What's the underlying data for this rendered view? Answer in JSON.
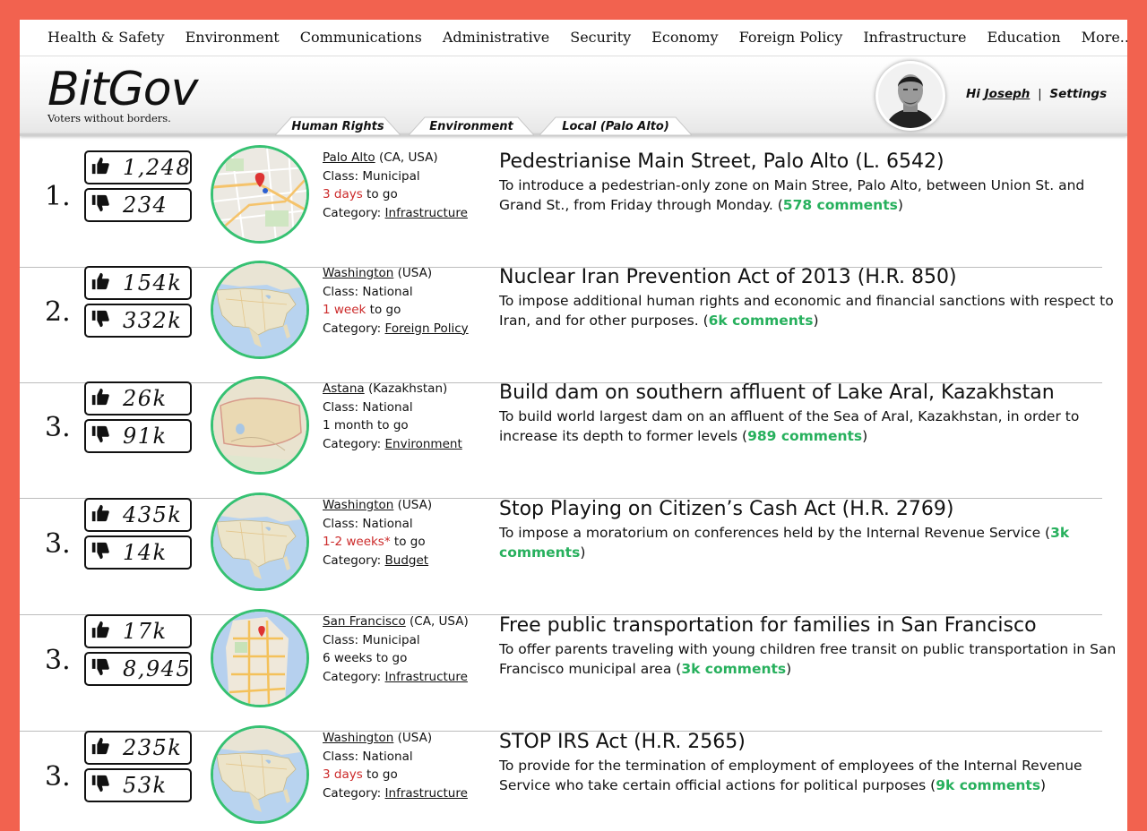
{
  "topnav": [
    "Health & Safety",
    "Environment",
    "Communications",
    "Administrative",
    "Security",
    "Economy",
    "Foreign Policy",
    "Infrastructure",
    "Education",
    "More..."
  ],
  "brand": {
    "logo": "BitGov",
    "tagline": "Voters without borders."
  },
  "user": {
    "greeting": "Hi",
    "name": "Joseph",
    "separator": "|",
    "settings": "Settings"
  },
  "tabs": [
    "Human Rights",
    "Environment",
    "Local (Palo Alto)"
  ],
  "colors": {
    "background": "#f2624f",
    "accent_green": "#36c172",
    "comment_green": "#27b05d",
    "deadline_red": "#cc2a2a"
  },
  "labels": {
    "class": "Class:",
    "category": "Category:",
    "to_go": "to go"
  },
  "items": [
    {
      "rank": "1.",
      "up": "1,248",
      "down": "234",
      "place": "Palo Alto",
      "place_note": " (CA, USA)",
      "class": "Municipal",
      "deadline": "3 days",
      "deadline_red": true,
      "category": "Infrastructure",
      "map": "city-map",
      "title": "Pedestrianise Main Street, Palo Alto (L. 6542)",
      "desc": "To introduce a pedestrian-only zone on Main Stree, Palo Alto, between Union St. and Grand St., from Friday through Monday. (",
      "comments": "578 comments",
      "close": ")"
    },
    {
      "rank": "2.",
      "up": "154k",
      "down": "332k",
      "place": "Washington",
      "place_note": " (USA)",
      "class": "National",
      "deadline": "1 week",
      "deadline_red": true,
      "category": "Foreign Policy",
      "map": "usa-map",
      "title": "Nuclear Iran Prevention Act of 2013 (H.R. 850)",
      "desc": "To impose additional human rights and economic and financial sanctions with respect to Iran, and for other purposes. (",
      "comments": "6k comments",
      "close": ")"
    },
    {
      "rank": "3.",
      "up": "26k",
      "down": "91k",
      "place": "Astana",
      "place_note": " (Kazakhstan)",
      "class": "National",
      "deadline": "1 month",
      "deadline_red": false,
      "category": "Environment",
      "map": "kazakhstan-map",
      "title": "Build dam on southern affluent of Lake Aral, Kazakhstan",
      "desc": "To build world largest dam on an affluent of the Sea of Aral, Kazakhstan, in order to increase its depth to former levels (",
      "comments": "989 comments",
      "close": ")"
    },
    {
      "rank": "3.",
      "up": "435k",
      "down": "14k",
      "place": "Washington",
      "place_note": " (USA)",
      "class": "National",
      "deadline": "1-2 weeks*",
      "deadline_red": true,
      "category": "Budget",
      "map": "usa-map",
      "title": "Stop Playing on Citizen’s Cash Act (H.R. 2769)",
      "desc": "To impose a moratorium on conferences held by the Internal Revenue Service (",
      "comments": "3k comments",
      "close": ")"
    },
    {
      "rank": "3.",
      "up": "17k",
      "down": "8,945",
      "place": "San Francisco",
      "place_note": " (CA, USA)",
      "class": "Municipal",
      "deadline": "6 weeks",
      "deadline_red": false,
      "category": "Infrastructure",
      "map": "sf-map",
      "title": "Free public transportation for families in San Francisco",
      "desc": "To offer parents traveling with young children free transit on public transportation in San Francisco municipal area (",
      "comments": "3k comments",
      "close": ")"
    },
    {
      "rank": "3.",
      "up": "235k",
      "down": "53k",
      "place": "Washington",
      "place_note": " (USA)",
      "class": "National",
      "deadline": "3 days",
      "deadline_red": true,
      "category": "Infrastructure",
      "map": "usa-map",
      "title": "STOP IRS Act (H.R. 2565)",
      "desc": "To provide for the termination of employment of employees of the Internal Revenue Service who take certain official actions for political purposes (",
      "comments": "9k comments",
      "close": ")"
    }
  ]
}
